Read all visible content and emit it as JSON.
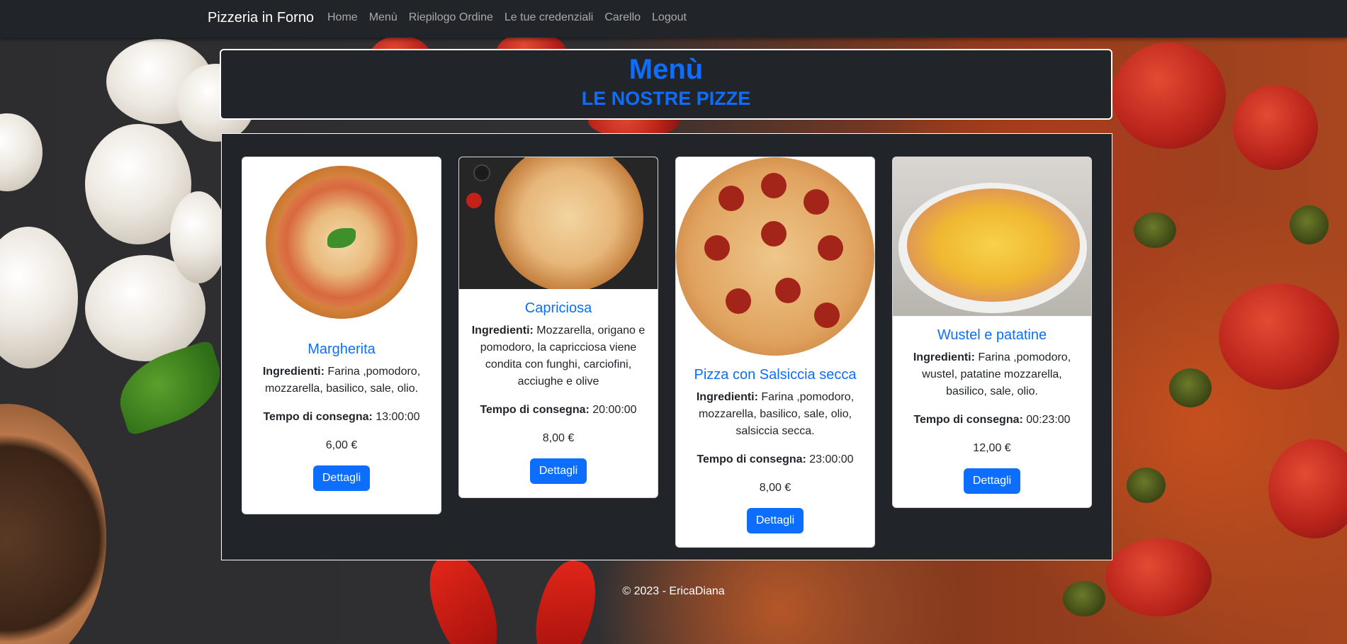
{
  "navbar": {
    "brand": "Pizzeria in Forno",
    "links": [
      "Home",
      "Menù",
      "Riepilogo Ordine",
      "Le tue credenziali",
      "Carello",
      "Logout"
    ]
  },
  "header": {
    "title": "Menù",
    "subtitle": "LE NOSTRE PIZZE"
  },
  "labels": {
    "ingredients": "Ingredienti:",
    "delivery_time": "Tempo di consegna:",
    "details_button": "Dettagli"
  },
  "pizzas": [
    {
      "name": "Margherita",
      "ingredients": "Farina ,pomodoro, mozzarella, basilico, sale, olio.",
      "delivery_time": "13:00:00",
      "price": "6,00 €"
    },
    {
      "name": "Capriciosa",
      "ingredients": "Mozzarella, origano e pomodoro, la capricciosa viene condita con funghi, carciofini, acciughe e olive",
      "delivery_time": "20:00:00",
      "price": "8,00 €"
    },
    {
      "name": "Pizza con Salsiccia secca",
      "ingredients": "Farina ,pomodoro, mozzarella, basilico, sale, olio, salsiccia secca.",
      "delivery_time": "23:00:00",
      "price": "8,00 €"
    },
    {
      "name": "Wustel e patatine",
      "ingredients": "Farina ,pomodoro, wustel, patatine mozzarella, basilico, sale, olio.",
      "delivery_time": "00:23:00",
      "price": "12,00 €"
    }
  ],
  "footer": "© 2023 - EricaDiana",
  "colors": {
    "navbar": "#212529",
    "accent": "#0d6efd",
    "panel": "#212529"
  }
}
